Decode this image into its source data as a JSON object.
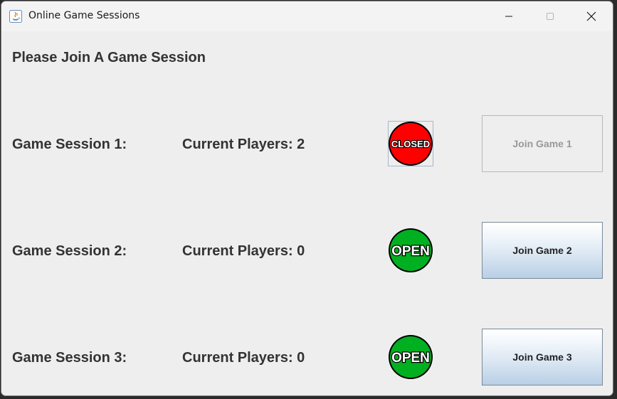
{
  "window": {
    "title": "Online Game Sessions"
  },
  "heading": "Please Join A Game Session",
  "sessions": [
    {
      "label": "Game Session 1:",
      "players": "Current Players: 2",
      "status": "CLOSED",
      "status_color": "#ff0000",
      "button_label": "Join Game 1",
      "button_enabled": false
    },
    {
      "label": "Game Session 2:",
      "players": "Current Players: 0",
      "status": "OPEN",
      "status_color": "#00b020",
      "button_label": "Join Game 2",
      "button_enabled": true
    },
    {
      "label": "Game Session 3:",
      "players": "Current Players: 0",
      "status": "OPEN",
      "status_color": "#00b020",
      "button_label": "Join Game 3",
      "button_enabled": true
    }
  ]
}
